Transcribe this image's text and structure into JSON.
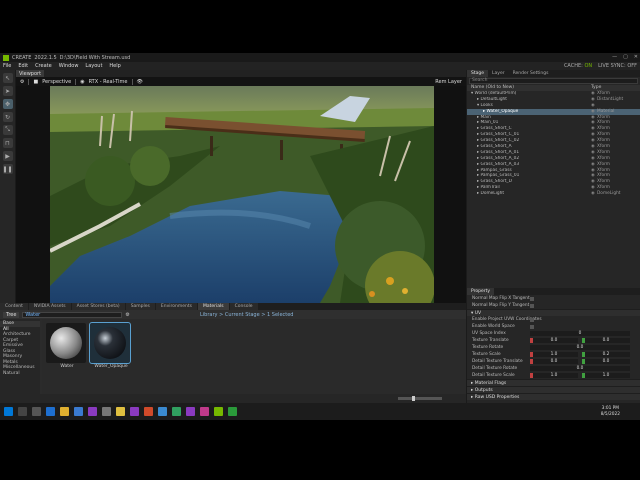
{
  "app": {
    "name": "CREATE",
    "version": "2022.1.5",
    "file": "D:\\3D\\Field With Stream.usd"
  },
  "menu": [
    "File",
    "Edit",
    "Create",
    "Window",
    "Layout",
    "Help"
  ],
  "status": {
    "cache_label": "CACHE:",
    "cache_value": "ON",
    "live_label": "LIVE SYNC:",
    "live_value": "OFF"
  },
  "viewport": {
    "tab": "Viewport",
    "camera": "Perspective",
    "renderer": "RTX - Real-Time",
    "layer": "Rem Layer"
  },
  "bottom_tabs": [
    "Content",
    "NVIDIA Assets",
    "Asset Stores (beta)",
    "Samples",
    "Environments",
    "Materials",
    "Console"
  ],
  "materials": {
    "tree_btn": "Tree",
    "search": "Water",
    "info": "Library > Current Stage > 1 Selected",
    "library_head": "Base",
    "library": [
      "All",
      "Architecture",
      "Carpet",
      "Emissive",
      "Glass",
      "Masonry",
      "Metals",
      "Miscellaneous",
      "Natural"
    ],
    "thumbs": [
      {
        "label": "Water"
      },
      {
        "label": "Water_Opaque"
      }
    ]
  },
  "stage": {
    "tabs": [
      "Stage",
      "Layer",
      "Render Settings"
    ],
    "search": "Search",
    "head_name": "Name (Old to New)",
    "head_type": "Type",
    "rows": [
      {
        "name": "World (defaultPrim)",
        "type": "Xform"
      },
      {
        "name": "DefaultLight",
        "type": "DistantLight"
      },
      {
        "name": "Looks",
        "type": ""
      },
      {
        "name": "Water_Opaque",
        "type": "Material"
      },
      {
        "name": "Main",
        "type": "Xform"
      },
      {
        "name": "Main_01",
        "type": "Xform"
      },
      {
        "name": "Grass_Short_C",
        "type": "Xform"
      },
      {
        "name": "Grass_Short_C_01",
        "type": "Xform"
      },
      {
        "name": "Grass_Short_C_02",
        "type": "Xform"
      },
      {
        "name": "Grass_Short_A",
        "type": "Xform"
      },
      {
        "name": "Grass_Short_A_01",
        "type": "Xform"
      },
      {
        "name": "Grass_Short_A_02",
        "type": "Xform"
      },
      {
        "name": "Grass_Short_A_03",
        "type": "Xform"
      },
      {
        "name": "Pampas_Grass",
        "type": "Xform"
      },
      {
        "name": "Pampas_Grass_01",
        "type": "Xform"
      },
      {
        "name": "Grass_Short_D",
        "type": "Xform"
      },
      {
        "name": "PalmTrail",
        "type": "Xform"
      },
      {
        "name": "DomeLight",
        "type": "DomeLight"
      }
    ]
  },
  "property": {
    "tab": "Property",
    "rows": [
      {
        "label": "Normal Map Flip X Tangent",
        "kind": "check"
      },
      {
        "label": "Normal Map Flip Y Tangent",
        "kind": "check"
      },
      {
        "label": "UV",
        "kind": "section"
      },
      {
        "label": "Enable Project UVW Coordinates",
        "kind": "check"
      },
      {
        "label": "Enable World Space",
        "kind": "check"
      },
      {
        "label": "UV Space Index",
        "kind": "wide",
        "v": "0"
      },
      {
        "label": "Texture Translate",
        "kind": "pair",
        "x": "0.0",
        "y": "0.0"
      },
      {
        "label": "Texture Rotate",
        "kind": "wide",
        "v": "0.0"
      },
      {
        "label": "Texture Scale",
        "kind": "pair",
        "x": "1.0",
        "y": "0.2"
      },
      {
        "label": "Detail Texture Translate",
        "kind": "pair",
        "x": "0.0",
        "y": "0.0"
      },
      {
        "label": "Detail Texture Rotate",
        "kind": "wide",
        "v": "0.0"
      },
      {
        "label": "Detail Texture Scale",
        "kind": "pair",
        "x": "1.0",
        "y": "1.0"
      }
    ],
    "sections": [
      "Material Flags",
      "Outputs",
      "Raw USD Properties"
    ]
  },
  "clock": {
    "time": "3:01 PM",
    "date": "8/5/2022"
  }
}
